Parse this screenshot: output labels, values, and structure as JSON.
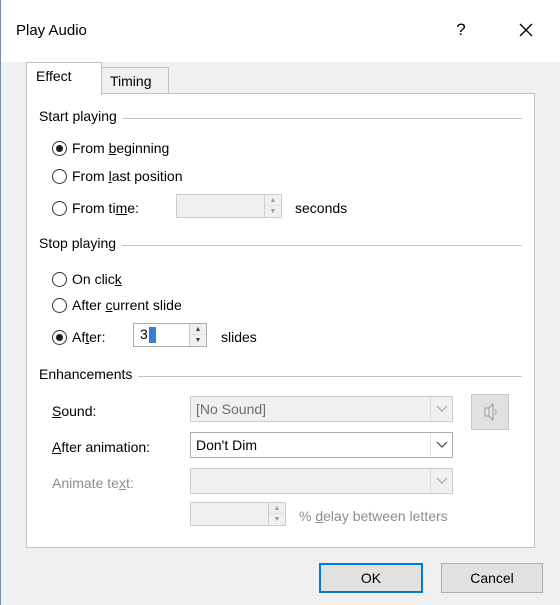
{
  "dialog": {
    "title": "Play Audio",
    "help_glyph": "?",
    "close_glyph": "✕"
  },
  "tabs": [
    {
      "label": "Effect",
      "active": true
    },
    {
      "label": "Timing",
      "active": false
    }
  ],
  "start_playing": {
    "title": "Start playing",
    "from_beginning": {
      "pre": "From ",
      "ul": "b",
      "post": "eginning",
      "checked": true
    },
    "from_last": {
      "pre": "From ",
      "ul": "l",
      "post": "ast position",
      "checked": false
    },
    "from_time": {
      "pre": "From ti",
      "ul": "m",
      "post": "e:",
      "checked": false
    },
    "time_value": "",
    "seconds_label": "seconds"
  },
  "stop_playing": {
    "title": "Stop playing",
    "on_click": {
      "pre": "On clic",
      "ul": "k",
      "post": "",
      "checked": false
    },
    "after_current": {
      "pre": "After ",
      "ul": "c",
      "post": "urrent slide",
      "checked": false
    },
    "after": {
      "pre": "Af",
      "ul": "t",
      "post": "er:",
      "checked": true
    },
    "after_value": "3",
    "slides_label": "slides"
  },
  "enhancements": {
    "title": "Enhancements",
    "sound_label": {
      "pre": "",
      "ul": "S",
      "post": "ound:"
    },
    "sound_value": "[No Sound]",
    "sound_icon": "speaker-icon",
    "after_animation_label": {
      "pre": "",
      "ul": "A",
      "post": "fter animation:"
    },
    "after_animation_value": "Don't Dim",
    "animate_text_label": {
      "pre": "Animate te",
      "ul": "x",
      "post": "t:"
    },
    "animate_text_value": "",
    "delay_value": "",
    "delay_label": {
      "pre": "% ",
      "ul": "d",
      "post": "elay between letters"
    }
  },
  "buttons": {
    "ok": "OK",
    "cancel": "Cancel"
  },
  "colors": {
    "accent": "#0078d7",
    "dialog_bg": "#f0f0f0",
    "panel_bg": "#ffffff"
  }
}
